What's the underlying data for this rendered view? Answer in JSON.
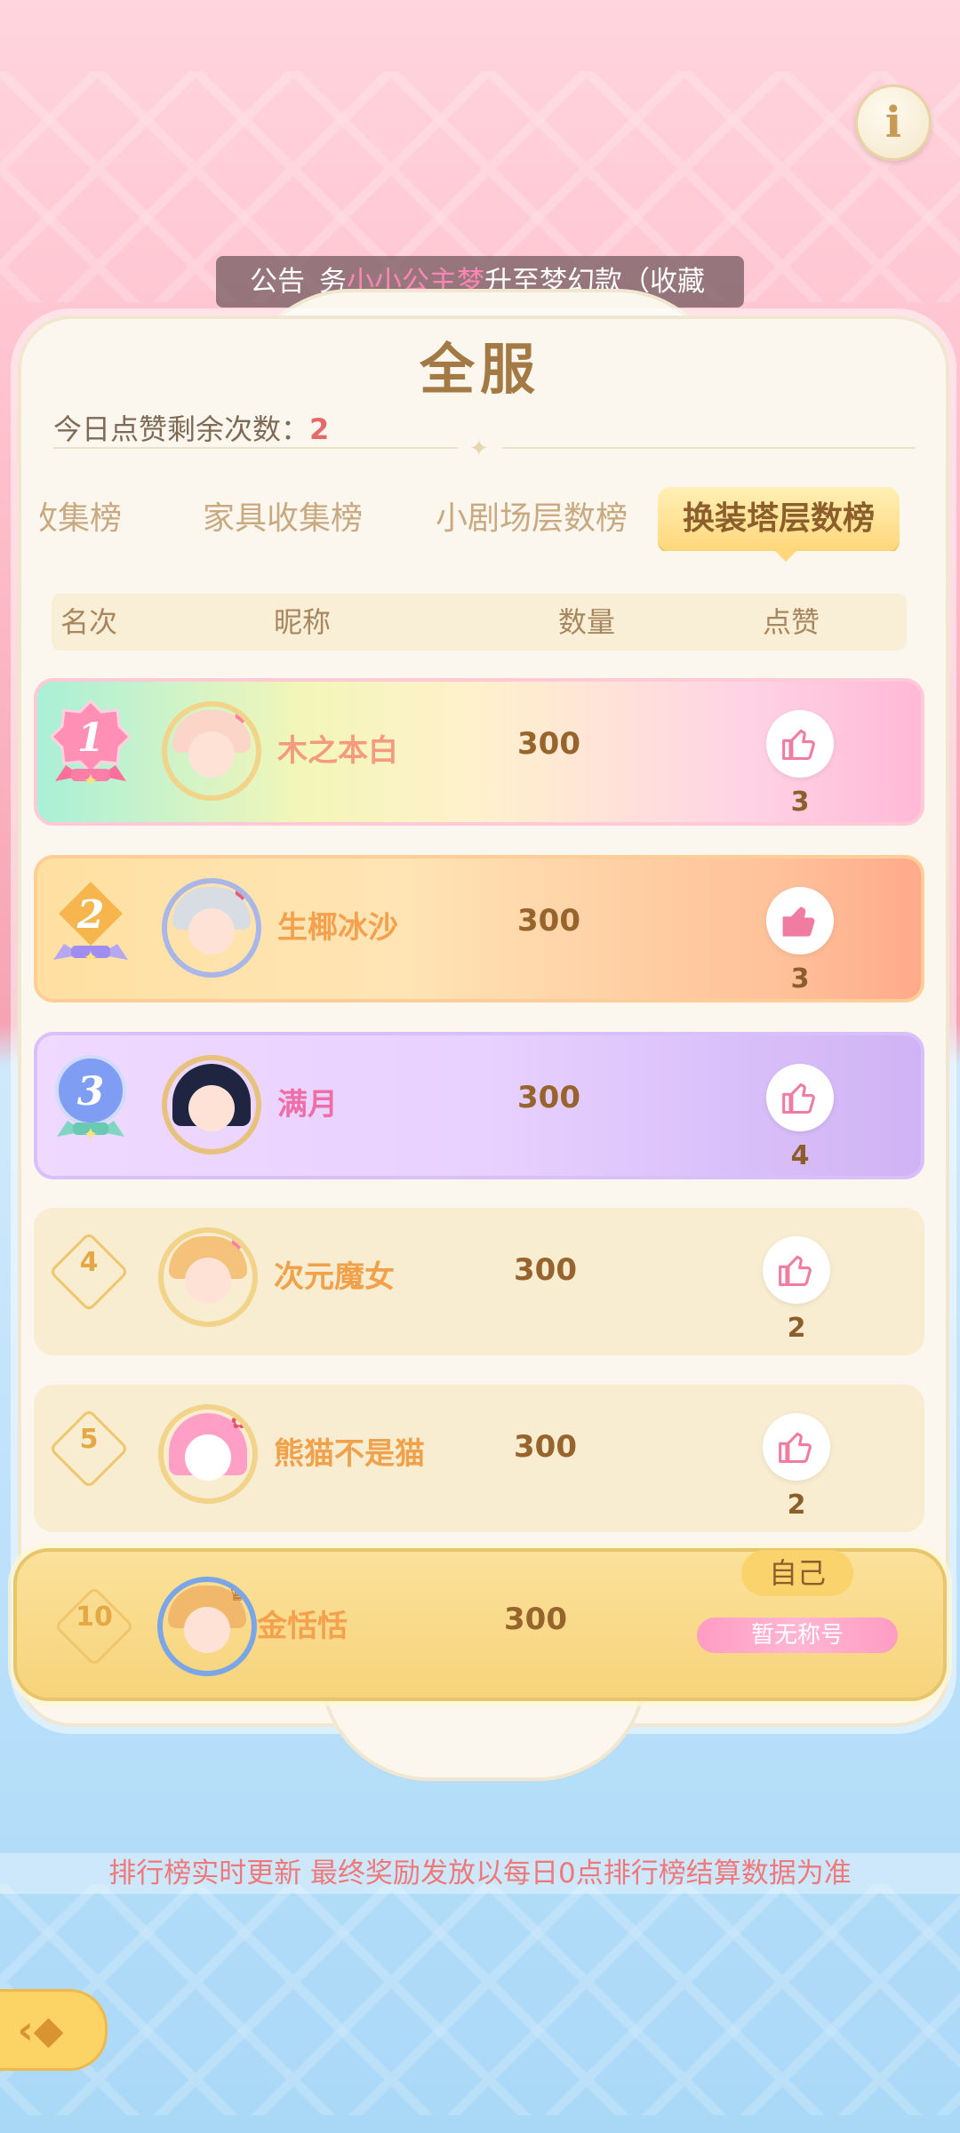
{
  "notice": {
    "label": "公告",
    "pre": "务",
    "highlight": "小小公主梦",
    "post": "升至梦幻款（收藏"
  },
  "header": {
    "title": "全服",
    "likes_remaining_label": "今日点赞剩余次数：",
    "likes_remaining": "2"
  },
  "tabs": [
    {
      "label": "收集榜"
    },
    {
      "label": "家具收集榜"
    },
    {
      "label": "小剧场层数榜"
    },
    {
      "label": "换装塔层数榜"
    }
  ],
  "table": {
    "col_rank": "名次",
    "col_name": "昵称",
    "col_qty": "数量",
    "col_like": "点赞"
  },
  "rows": [
    {
      "rank": "1",
      "name": "木之本白",
      "qty": "300",
      "likes": "3"
    },
    {
      "rank": "2",
      "name": "生椰冰沙",
      "qty": "300",
      "likes": "3"
    },
    {
      "rank": "3",
      "name": "满月",
      "qty": "300",
      "likes": "4"
    },
    {
      "rank": "4",
      "name": "次元魔女",
      "qty": "300",
      "likes": "2"
    },
    {
      "rank": "5",
      "name": "熊猫不是猫",
      "qty": "300",
      "likes": "2"
    }
  ],
  "self_row": {
    "rank": "10",
    "name": "金恬恬",
    "qty": "300",
    "tag": "自己",
    "title": "暂无称号"
  },
  "footer_note": "排行榜实时更新 最终奖励发放以每日0点排行榜结算数据为准",
  "colors": {
    "accent": "#fbd36c",
    "rank_text": "#e4a844",
    "pink": "#f27fae"
  }
}
